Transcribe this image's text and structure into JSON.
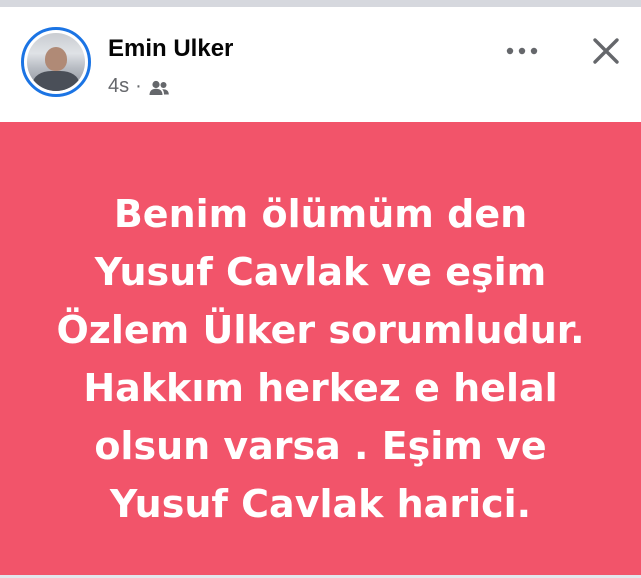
{
  "post": {
    "author": "Emin Ulker",
    "time": "4s",
    "separator": "·",
    "audience_icon": "friends-icon",
    "more_icon": "more-options-icon",
    "close_icon": "close-icon",
    "text_lines": [
      "Benim ölümüm den",
      "Yusuf Cavlak ve eşim",
      "Özlem Ülker sorumludur.",
      "Hakkım herkez e helal",
      "olsun varsa . Eşim ve",
      "Yusuf Cavlak harici."
    ],
    "background_color": "#f2546a",
    "text_color": "#ffffff"
  }
}
